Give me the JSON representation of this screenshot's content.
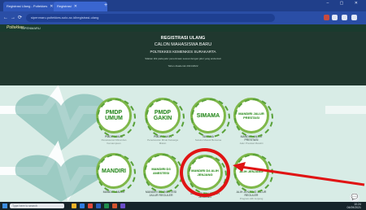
{
  "browser": {
    "tabs": [
      {
        "label": "Registrasi Ulang - Poltekkes",
        "active": false
      },
      {
        "label": "Registrasi",
        "active": true
      }
    ],
    "new_tab": "+",
    "url": "sipenmaru.poltekkes-solo.ac.id/registrasi-ulang",
    "window_controls": "–  ▢  ✕"
  },
  "site": {
    "logo_text": "Poltekkes",
    "nav_text": "SIPENMARU"
  },
  "hero": {
    "title_1": "REGISTRASI ULANG",
    "title_2": "CALON MAHASISWA BARU",
    "title_3": "POLTEKKES KEMENKES SURAKARTA",
    "subtitle_1": "Silakan klik pada jalur penerimaan sesuai dengan jalur yang anda ikuti",
    "subtitle_2": "Tahun Akademik 2021/2022"
  },
  "cards_row1": [
    {
      "badge": "PMDP UMUM",
      "label": "PMDP UMUM",
      "desc": "Penelusuran Minat dan Kemampuan"
    },
    {
      "badge": "PMDP GAKIN",
      "label": "PMDP GAKIN",
      "desc": "Penelusuran Minat Keluarga Miskin"
    },
    {
      "badge": "SIMAMA",
      "label": "SIMAMA",
      "desc": "Seleksi Masuk Bersama"
    },
    {
      "badge": "MANDIRI JALUR PRESTASI",
      "label": "MANDIRI JALUR PRESTASI",
      "desc": "Jalur Prestasi Mandiri"
    }
  ],
  "cards_row2": [
    {
      "badge": "MANDIRI",
      "label": "MANDIRI JALUR",
      "desc": ""
    },
    {
      "badge": "MANDIRI D3 ANESTESI",
      "label": "MANDIRI D3 ANESTESI JALUR REGULER",
      "desc": ""
    },
    {
      "badge": "MANDIRI D4 ALIH JENJANG",
      "label": "MANDIRI JALUR ALIH JENJANG",
      "desc": ""
    },
    {
      "badge": "ALIH JENJANG",
      "label": "ALIH JENJANG JALUR REGULER",
      "desc": "Program Alih Jenjang"
    }
  ],
  "taskbar": {
    "search_placeholder": "Type here to search",
    "time": "10:24",
    "date": "04/09/2021"
  },
  "fab_icon": "chat-icon",
  "colors": {
    "highlight": "#e01414",
    "arrow": "#e01414",
    "badge_green": "#7fb84a"
  }
}
